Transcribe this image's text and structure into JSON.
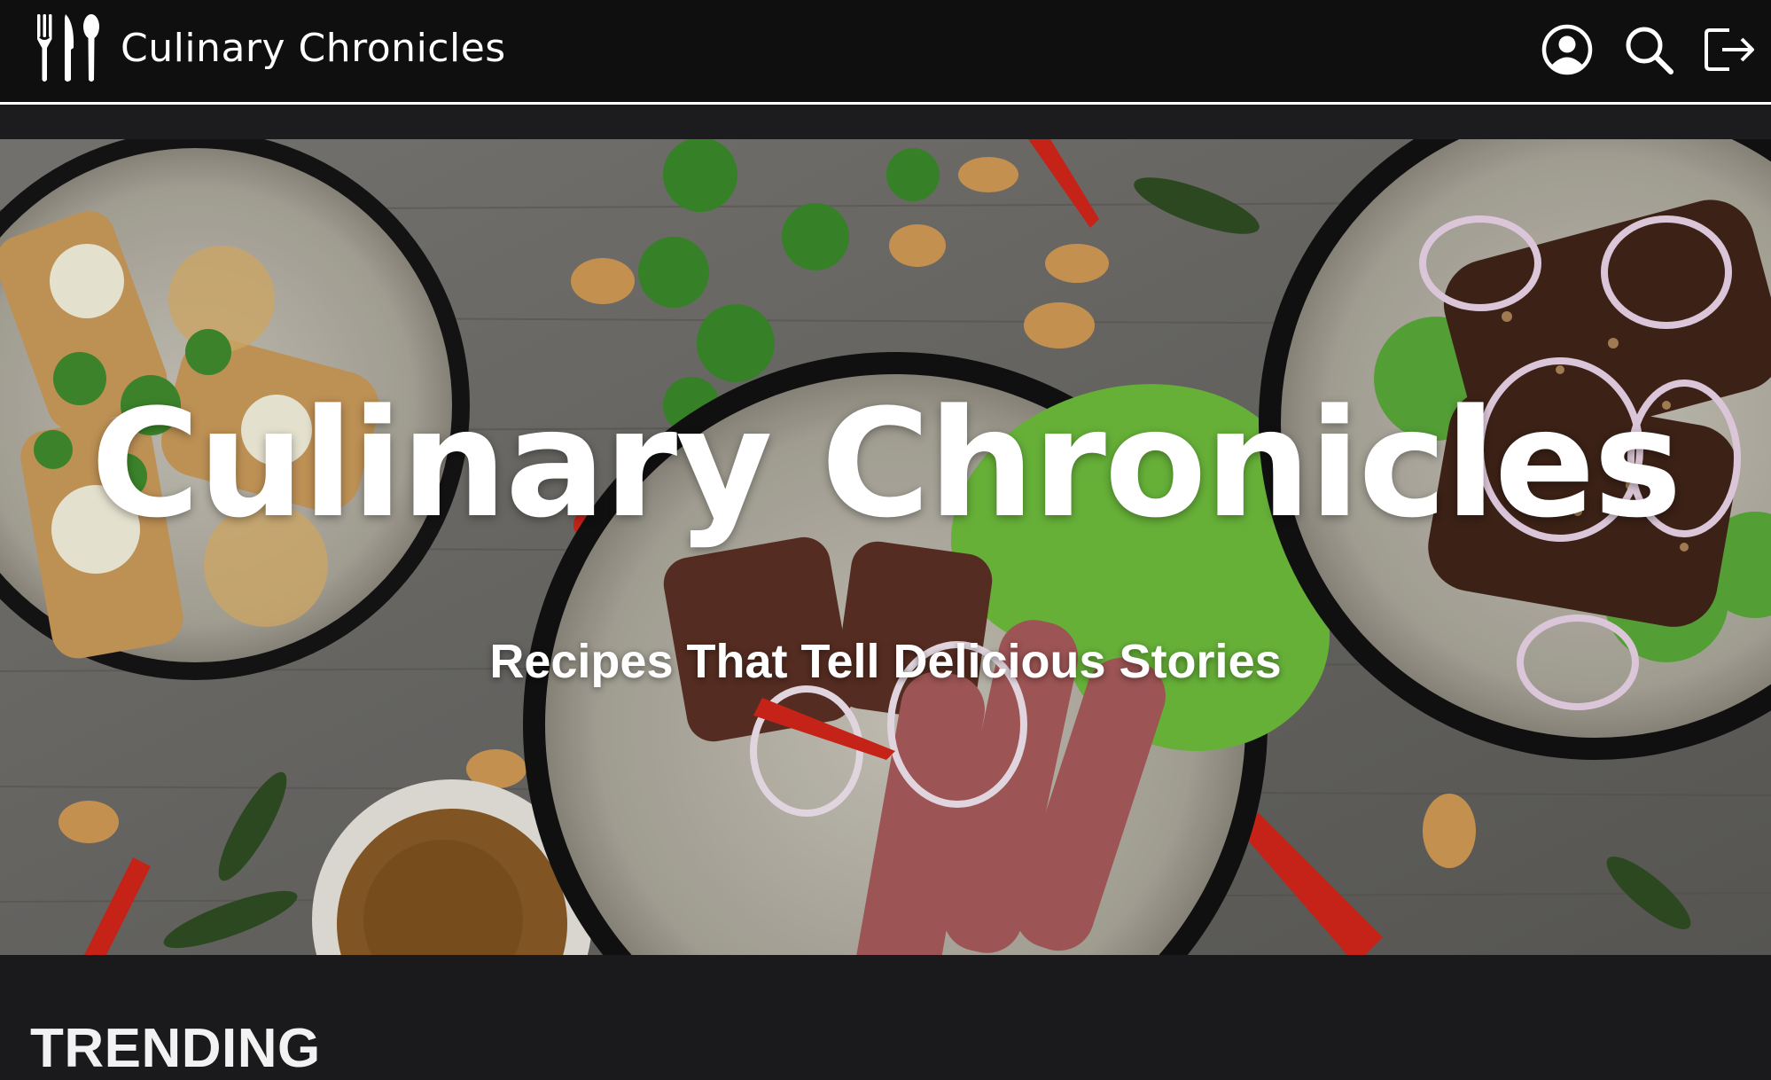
{
  "header": {
    "brand_name": "Culinary Chronicles",
    "brand_icon": "utensils-icon",
    "actions": [
      {
        "icon": "account-circle-icon"
      },
      {
        "icon": "search-icon"
      },
      {
        "icon": "logout-icon"
      }
    ]
  },
  "hero": {
    "title": "Culinary Chronicles",
    "subtitle": "Recipes That Tell Delicious Stories"
  },
  "sections": {
    "trending_title": "TRENDING"
  },
  "colors": {
    "topbar": "#0f0f10",
    "page_background": "#1a1a1c",
    "text": "#ffffff"
  }
}
